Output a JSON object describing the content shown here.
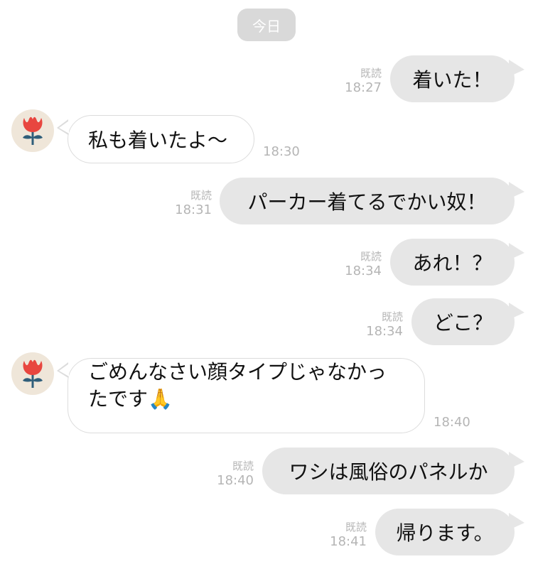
{
  "date_divider": "今日",
  "messages": [
    {
      "side": "out",
      "text": "着いた！",
      "read": "既読",
      "time": "18:27"
    },
    {
      "side": "in",
      "text": "私も着いたよ〜",
      "time": "18:30"
    },
    {
      "side": "out",
      "text": "パーカー着てるでかい奴！",
      "read": "既読",
      "time": "18:31"
    },
    {
      "side": "out",
      "text": "あれ！？",
      "read": "既読",
      "time": "18:34"
    },
    {
      "side": "out",
      "text": "どこ？",
      "read": "既読",
      "time": "18:34"
    },
    {
      "side": "in",
      "text_line1": "ごめんなさい顔タイプじゃなかっ",
      "text_line2": "たです🙏",
      "time": "18:40"
    },
    {
      "side": "out",
      "text": "ワシは風俗のパネルか",
      "read": "既読",
      "time": "18:40"
    },
    {
      "side": "out",
      "text": "帰ります。",
      "read": "既読",
      "time": "18:41"
    }
  ],
  "avatar_icon": "red-flower-icon",
  "colors": {
    "outgoing_bubble": "#e6e6e6",
    "incoming_bubble": "#ffffff",
    "meta_text": "#b5b5b5",
    "flower": "#e8463f",
    "stem": "#2f5e7a"
  }
}
